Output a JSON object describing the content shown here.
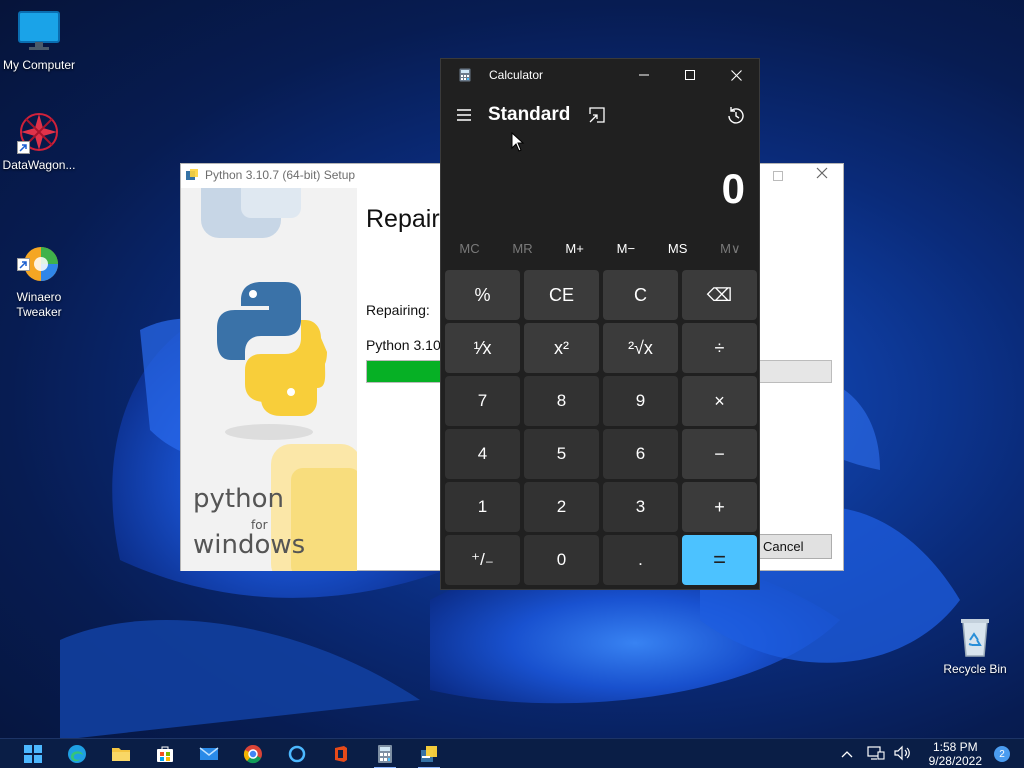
{
  "desktop": {
    "icons": [
      {
        "label": "My Computer",
        "icon": "monitor-icon"
      },
      {
        "label": "DataWagon...",
        "icon": "datawagon-icon"
      },
      {
        "label": "Winaero\nTweaker",
        "icon": "winaero-icon"
      },
      {
        "label": "Recycle Bin",
        "icon": "recycle-bin-icon"
      }
    ]
  },
  "python_setup": {
    "title": "Python 3.10.7 (64-bit) Setup",
    "heading": "Repair",
    "status_label": "Repairing:",
    "item_label": "Python 3.10",
    "progress": 0.16,
    "cancel_label": "Cancel",
    "brand_top": "python",
    "brand_mid": "for",
    "brand_bottom": "windows"
  },
  "calculator": {
    "title": "Calculator",
    "mode": "Standard",
    "display": "0",
    "memory": [
      "MC",
      "MR",
      "M+",
      "M−",
      "MS",
      "M∨"
    ],
    "memory_disabled": [
      true,
      true,
      false,
      false,
      false,
      true
    ],
    "keys": [
      {
        "label": "%",
        "kind": "op"
      },
      {
        "label": "CE",
        "kind": "op"
      },
      {
        "label": "C",
        "kind": "op"
      },
      {
        "label": "⌫",
        "kind": "op"
      },
      {
        "label": "¹⁄x",
        "kind": "op"
      },
      {
        "label": "x²",
        "kind": "op"
      },
      {
        "label": "²√x",
        "kind": "op"
      },
      {
        "label": "÷",
        "kind": "op"
      },
      {
        "label": "7",
        "kind": "num"
      },
      {
        "label": "8",
        "kind": "num"
      },
      {
        "label": "9",
        "kind": "num"
      },
      {
        "label": "×",
        "kind": "op"
      },
      {
        "label": "4",
        "kind": "num"
      },
      {
        "label": "5",
        "kind": "num"
      },
      {
        "label": "6",
        "kind": "num"
      },
      {
        "label": "−",
        "kind": "op"
      },
      {
        "label": "1",
        "kind": "num"
      },
      {
        "label": "2",
        "kind": "num"
      },
      {
        "label": "3",
        "kind": "num"
      },
      {
        "label": "+",
        "kind": "op"
      },
      {
        "label": "⁺/₋",
        "kind": "num"
      },
      {
        "label": "0",
        "kind": "num"
      },
      {
        "label": ".",
        "kind": "num"
      },
      {
        "label": "=",
        "kind": "eq"
      }
    ]
  },
  "taskbar": {
    "apps": [
      "start-icon",
      "edge-icon",
      "file-explorer-icon",
      "store-icon",
      "mail-icon",
      "chrome-icon",
      "cortana-icon",
      "office-icon",
      "calculator-icon",
      "python-setup-icon"
    ],
    "time": "1:58 PM",
    "date": "9/28/2022",
    "notifications": "2"
  }
}
